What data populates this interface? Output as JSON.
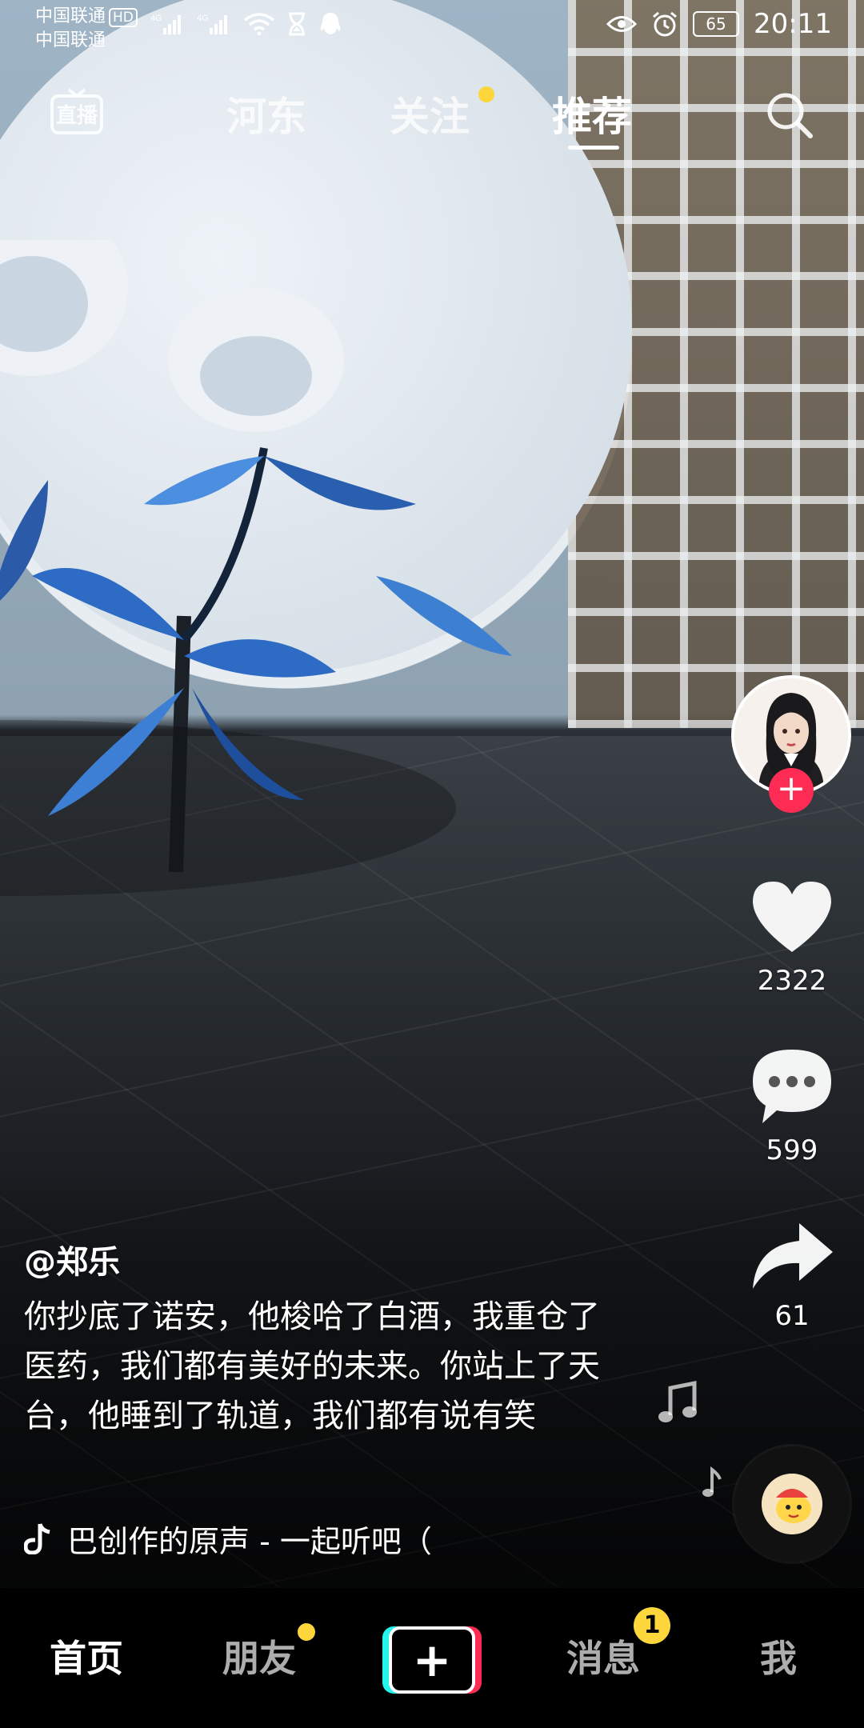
{
  "status_bar": {
    "carrier_line1": "中国联通",
    "hd_badge": "HD",
    "carrier_line2": "中国联通",
    "network_1": "4G",
    "network_2": "4G",
    "battery_level": "65",
    "time": "20:11"
  },
  "top_nav": {
    "live_label": "直播",
    "tabs": [
      {
        "label": "河东"
      },
      {
        "label": "关注",
        "has_dot": true
      },
      {
        "label": "推荐",
        "active": true
      }
    ]
  },
  "rail": {
    "like_count": "2322",
    "comment_count": "599",
    "share_count": "61"
  },
  "post": {
    "username": "@郑乐",
    "caption": "你抄底了诺安，他梭哈了白酒，我重仓了医药，我们都有美好的未来。你站上了天台，他睡到了轨道，我们都有说有笑",
    "music_text": "巴创作的原声 - 一起听吧（"
  },
  "bottom_nav": {
    "items": [
      {
        "label": "首页",
        "active": true
      },
      {
        "label": "朋友",
        "has_dot": true
      },
      {
        "label": "+"
      },
      {
        "label": "消息",
        "badge": "1"
      },
      {
        "label": "我"
      }
    ]
  },
  "colors": {
    "accent_red": "#fe2c55",
    "accent_cyan": "#25f4ee",
    "notify_yellow": "#fcd63a"
  },
  "icons": [
    "live-icon",
    "search-icon",
    "heart-icon",
    "comment-icon",
    "share-icon",
    "music-note-icon",
    "tiktok-note-icon",
    "music-disc-icon"
  ]
}
